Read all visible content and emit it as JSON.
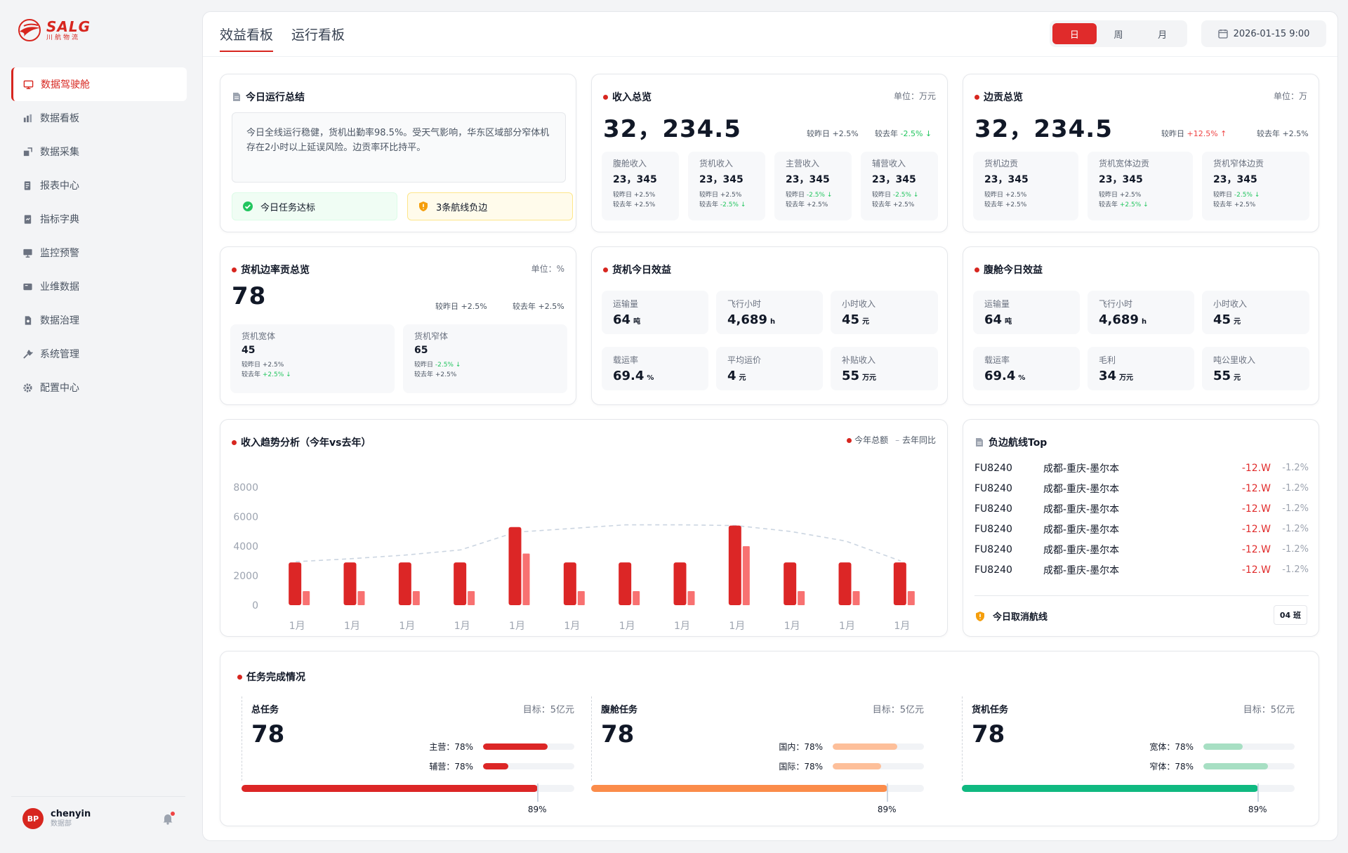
{
  "app": {
    "logo_text": "SALG",
    "logo_sub": "川航物流"
  },
  "sidebar": {
    "items": [
      {
        "label": "数据驾驶舱",
        "icon": "monitor-icon"
      },
      {
        "label": "数据看板",
        "icon": "chart-icon"
      },
      {
        "label": "数据采集",
        "icon": "collect-icon"
      },
      {
        "label": "报表中心",
        "icon": "report-icon"
      },
      {
        "label": "指标字典",
        "icon": "book-icon"
      },
      {
        "label": "监控预警",
        "icon": "screen-icon"
      },
      {
        "label": "业维数据",
        "icon": "database-icon"
      },
      {
        "label": "数据治理",
        "icon": "govern-icon"
      },
      {
        "label": "系统管理",
        "icon": "tool-icon"
      },
      {
        "label": "配置中心",
        "icon": "gear-icon"
      }
    ],
    "user": {
      "initials": "BP",
      "name": "chenyin",
      "dept": "数据部"
    }
  },
  "header": {
    "tabs": [
      "效益看板",
      "运行看板"
    ],
    "periods": [
      "日",
      "周",
      "月"
    ],
    "date": "2026-01-15 9:00"
  },
  "summary": {
    "title": "今日运行总结",
    "text": "今日全线运行稳健，货机出勤率98.5%。受天气影响，华东区域部分窄体机存在2小时以上延误风险。边贡率环比持平。",
    "badge_ok": "今日任务达标",
    "badge_warn": "3条航线负边"
  },
  "revenue": {
    "title": "收入总览",
    "unit": "单位：万元",
    "value": "32，234.5",
    "vs_day_label": "较昨日",
    "vs_day": "+2.5%",
    "vs_year_label": "较去年",
    "vs_year": "-2.5%",
    "items": [
      {
        "label": "腹舱收入",
        "value": "23，345",
        "day": "+2.5%",
        "year": "+2.5%"
      },
      {
        "label": "货机收入",
        "value": "23，345",
        "day": "+2.5%",
        "year": "-2.5%"
      },
      {
        "label": "主营收入",
        "value": "23，345",
        "day": "-2.5%",
        "year": "+2.5%"
      },
      {
        "label": "辅营收入",
        "value": "23，345",
        "day": "-2.5%",
        "year": "+2.5%"
      }
    ]
  },
  "margin": {
    "title": "边贡总览",
    "unit": "单位：万",
    "value": "32，234.5",
    "vs_day_label": "较昨日",
    "vs_day": "+12.5%",
    "vs_year_label": "较去年",
    "vs_year": "+2.5%",
    "items": [
      {
        "label": "货机边贡",
        "value": "23，345",
        "day": "+2.5%",
        "year": "+2.5%"
      },
      {
        "label": "货机宽体边贡",
        "value": "23，345",
        "day": "+2.5%",
        "year": "+2.5%"
      },
      {
        "label": "货机窄体边贡",
        "value": "23，345",
        "day": "-2.5%",
        "year": "+2.5%"
      }
    ]
  },
  "cargo_margin": {
    "title": "货机边率贡总览",
    "unit": "单位：%",
    "value": "78",
    "vs_day_label": "较昨日",
    "vs_day": "+2.5%",
    "vs_year_label": "较去年",
    "vs_year": "+2.5%",
    "items": [
      {
        "label": "货机宽体",
        "value": "45",
        "day": "+2.5%",
        "year": "+2.5%"
      },
      {
        "label": "货机窄体",
        "value": "65",
        "day": "-2.5%",
        "year": "+2.5%"
      }
    ]
  },
  "cargo_today": {
    "title": "货机今日效益",
    "metrics": [
      {
        "label": "运输量",
        "value": "64",
        "unit": "吨"
      },
      {
        "label": "飞行小时",
        "value": "4,689",
        "unit": "h"
      },
      {
        "label": "小时收入",
        "value": "45",
        "unit": "元"
      },
      {
        "label": "载运率",
        "value": "69.4",
        "unit": "%"
      },
      {
        "label": "平均运价",
        "value": "4",
        "unit": "元"
      },
      {
        "label": "补贴收入",
        "value": "55",
        "unit": "万元"
      }
    ]
  },
  "belly_today": {
    "title": "腹舱今日效益",
    "metrics": [
      {
        "label": "运输量",
        "value": "64",
        "unit": "吨"
      },
      {
        "label": "飞行小时",
        "value": "4,689",
        "unit": "h"
      },
      {
        "label": "小时收入",
        "value": "45",
        "unit": "元"
      },
      {
        "label": "载运率",
        "value": "69.4",
        "unit": "%"
      },
      {
        "label": "毛利",
        "value": "34",
        "unit": "万元"
      },
      {
        "label": "吨公里收入",
        "value": "55",
        "unit": "元"
      }
    ]
  },
  "chart_data": {
    "type": "bar",
    "title": "收入趋势分析（今年vs去年）",
    "categories": [
      "1月",
      "1月",
      "1月",
      "1月",
      "1月",
      "1月",
      "1月",
      "1月",
      "1月",
      "1月",
      "1月",
      "1月"
    ],
    "series": [
      {
        "name": "今年总额",
        "values": [
          2900,
          2900,
          2900,
          2900,
          5300,
          2900,
          2900,
          2900,
          5400,
          2900,
          2900,
          2900
        ]
      },
      {
        "name": "去年同比",
        "values": [
          950,
          950,
          950,
          950,
          3500,
          950,
          950,
          950,
          4000,
          950,
          950,
          950
        ]
      }
    ],
    "trend_line": [
      2950,
      3150,
      3400,
      3750,
      4950,
      5200,
      5450,
      5450,
      5400,
      5000,
      4350,
      3000
    ],
    "yticks": [
      0,
      2000,
      4000,
      6000,
      8000
    ],
    "ylim": [
      0,
      8000
    ],
    "colors": {
      "current": "#dc2626",
      "last": "#f87171",
      "line": "#cbd5e1"
    }
  },
  "routes": {
    "title": "负边航线Top",
    "rows": [
      {
        "code": "FU8240",
        "name": "成都-重庆-墨尔本",
        "value": "-12.W",
        "pct": "-1.2%"
      },
      {
        "code": "FU8240",
        "name": "成都-重庆-墨尔本",
        "value": "-12.W",
        "pct": "-1.2%"
      },
      {
        "code": "FU8240",
        "name": "成都-重庆-墨尔本",
        "value": "-12.W",
        "pct": "-1.2%"
      },
      {
        "code": "FU8240",
        "name": "成都-重庆-墨尔本",
        "value": "-12.W",
        "pct": "-1.2%"
      },
      {
        "code": "FU8240",
        "name": "成都-重庆-墨尔本",
        "value": "-12.W",
        "pct": "-1.2%"
      },
      {
        "code": "FU8240",
        "name": "成都-重庆-墨尔本",
        "value": "-12.W",
        "pct": "-1.2%"
      }
    ],
    "cancel_label": "今日取消航线",
    "cancel_count": "04 班"
  },
  "tasks": {
    "title": "任务完成情况",
    "cols": [
      {
        "name": "总任务",
        "goal": "目标：5亿元",
        "value": "78",
        "pct": "89%",
        "progress": 0.89,
        "color": "#dc2626",
        "bars": [
          {
            "label": "主营：78%",
            "progress": 0.71,
            "color": "#dc2626"
          },
          {
            "label": "辅营：78%",
            "progress": 0.28,
            "color": "#dc2626"
          }
        ]
      },
      {
        "name": "腹舱任务",
        "goal": "目标：5亿元",
        "value": "78",
        "pct": "89%",
        "progress": 0.89,
        "color": "#fb8c4a",
        "bars": [
          {
            "label": "国内：78%",
            "progress": 0.71,
            "color": "#fdbf9a"
          },
          {
            "label": "国际：78%",
            "progress": 0.53,
            "color": "#fdbf9a"
          }
        ]
      },
      {
        "name": "货机任务",
        "goal": "目标：5亿元",
        "value": "78",
        "pct": "89%",
        "progress": 0.89,
        "color": "#10b981",
        "bars": [
          {
            "label": "宽体：78%",
            "progress": 0.43,
            "color": "#a7dfc3"
          },
          {
            "label": "窄体：78%",
            "progress": 0.71,
            "color": "#a7dfc3"
          }
        ]
      }
    ]
  }
}
